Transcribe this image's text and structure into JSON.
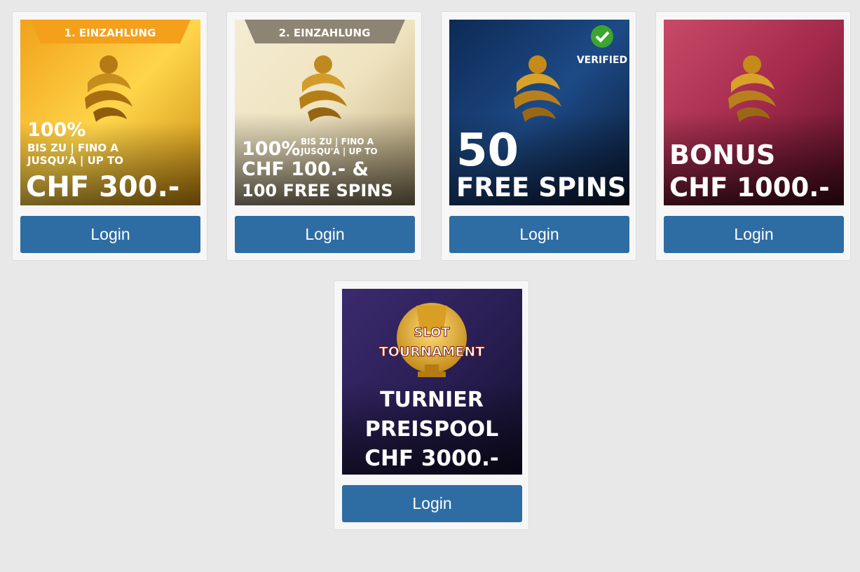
{
  "promos": [
    {
      "ribbon": "1. EINZAHLUNG",
      "line1": "100%",
      "line2": "BIS ZU | FINO A",
      "line3": "JUSQU'À | UP TO",
      "amount": "CHF 300.-",
      "button_label": "Login"
    },
    {
      "ribbon": "2. EINZAHLUNG",
      "line1": "100%",
      "line2": "BIS ZU | FINO A",
      "line3": "JUSQU'À | UP TO",
      "amount": "CHF 100.- &",
      "extra": "100 FREE SPINS",
      "button_label": "Login"
    },
    {
      "badge": "VERIFIED",
      "big_number": "50",
      "text": "FREE SPINS",
      "button_label": "Login"
    },
    {
      "line1": "BONUS",
      "amount": "CHF 1000.-",
      "button_label": "Login"
    },
    {
      "trophy_line1": "SLOT",
      "trophy_line2": "TOURNAMENT",
      "line1": "TURNIER",
      "line2": "PREISPOOL",
      "amount": "CHF 3000.-",
      "button_label": "Login"
    }
  ],
  "colors": {
    "button_bg": "#2e6ca4",
    "page_bg": "#e8e8e8",
    "card_bg": "#f7f7f7",
    "gold": "#d9a52a"
  },
  "icons": [
    "brand-logo-icon",
    "verified-check-icon",
    "trophy-icon"
  ]
}
